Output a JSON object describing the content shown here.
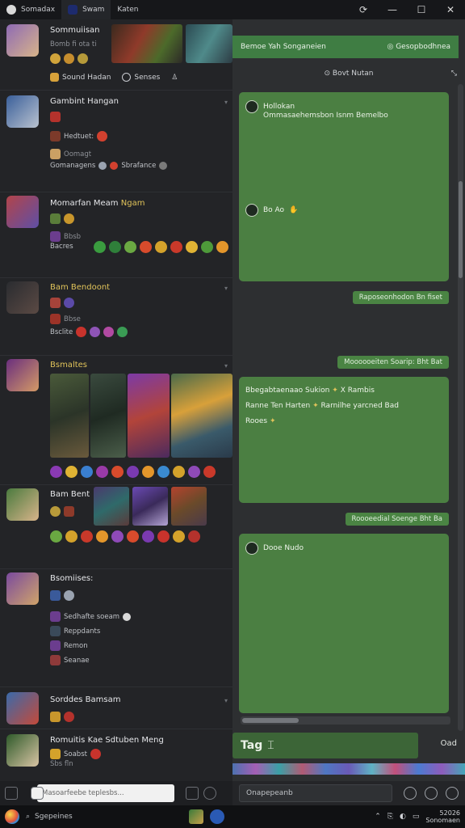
{
  "window": {
    "tabs": [
      {
        "label": "Somadax",
        "icon": "game-controller-icon"
      },
      {
        "label": "Swam",
        "icon": "steam-icon"
      },
      {
        "label": "Katen",
        "icon": ""
      }
    ],
    "controls": [
      "refresh-icon",
      "minimize-icon",
      "maximize-icon",
      "close-icon"
    ]
  },
  "feed": {
    "items": [
      {
        "name": "Sommuiisan",
        "sub1": "Bomb fi ota ti",
        "quick": [
          {
            "icon": "people-icon",
            "label": "Sound Hadan"
          },
          {
            "icon": "gear-icon",
            "label": "Senses"
          }
        ]
      },
      {
        "name": "Gambint Hangan",
        "sub1": "Hedtuet:",
        "sub2": "Oomagt",
        "sub3": "Gomanagens",
        "tail": "Sbrafance"
      },
      {
        "name": "Momarfan Meam",
        "name_tag": "Ngam",
        "sub1": "Bbsb",
        "sub2": "Bacres"
      },
      {
        "name": "Bam Bendoont",
        "sub1": "Bbse",
        "sub2": "Bsclite"
      },
      {
        "name": "Bsmaltes"
      },
      {
        "name": "Bam Bent"
      },
      {
        "name": "Bsomiises:",
        "lines": [
          "Sedhafte soeam",
          "Reppdants",
          "Remon",
          "Seanae"
        ]
      },
      {
        "name": "Sorddes Bamsam"
      },
      {
        "name": "Romuitis Kae Sdtuben Meng",
        "sub1": "Soabst",
        "sub2": "Sbs fln"
      }
    ]
  },
  "composer_left": {
    "placeholder": "Masoarfeebe teplesbs..."
  },
  "panel": {
    "header_title": "Bemoe Yah Songaneien",
    "header_right": "Gesopbodhnea",
    "subheader": "Bovt Nutan",
    "cards": [
      {
        "name": "Hollokan",
        "text": "Ommasaehemsbon Isnm Bemelbo"
      },
      {
        "name": "Bo Ao"
      },
      {
        "name": "Dooe Nudo"
      }
    ],
    "pills": [
      "Raposeonhodon Bn fiset",
      "Moooooeiten Soarip: Bht Bat",
      "Roooeedial Soenge Bht Ba"
    ],
    "long_message": [
      "Bbegabtaenaao Sukion",
      "X Rambis",
      "Ranne Ten Harten",
      "Rarnilhe yarcned Bad",
      "Rooes"
    ],
    "input_value": "Tag",
    "input_side": "Oad",
    "composer_placeholder": "Onapepeanb"
  },
  "taskbar": {
    "search_label": "Sgepeines",
    "clock_line1": "52026",
    "clock_line2": "Sonomaen"
  }
}
